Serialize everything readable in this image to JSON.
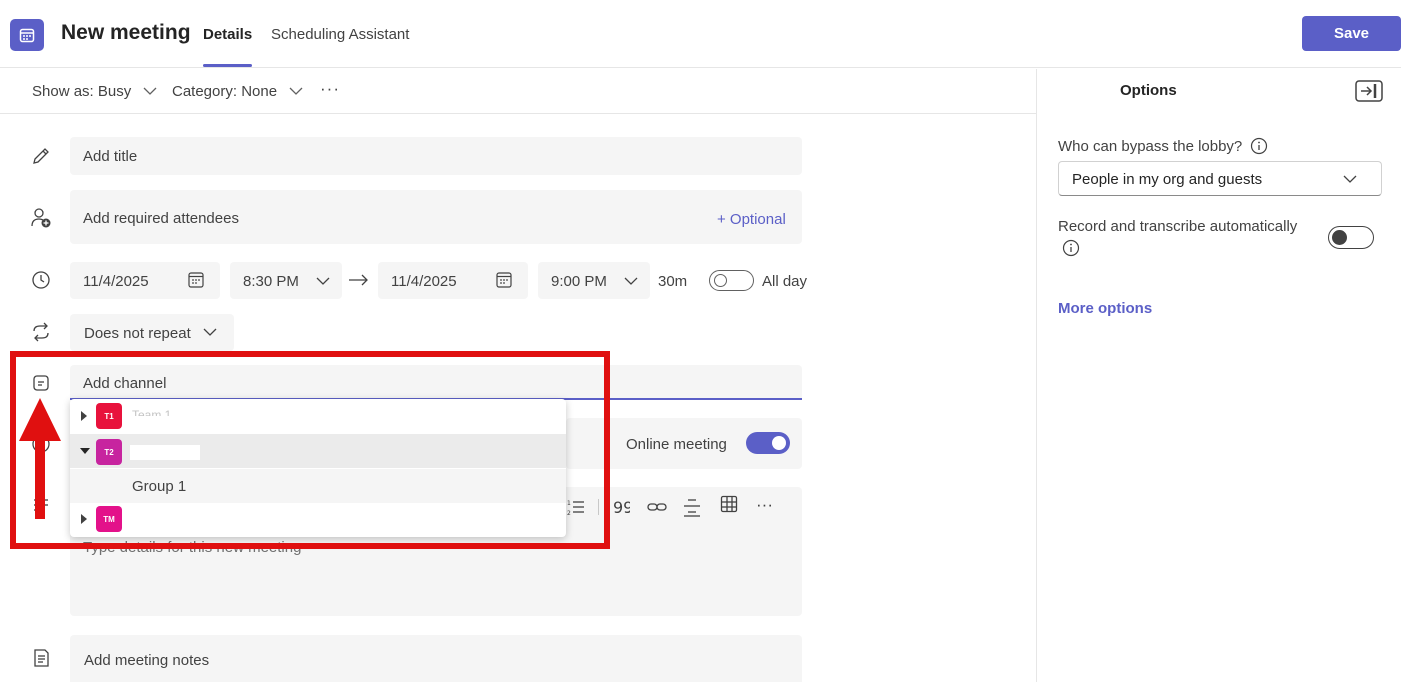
{
  "header": {
    "title": "New meeting",
    "tabs": [
      {
        "label": "Details"
      },
      {
        "label": "Scheduling Assistant"
      }
    ],
    "save_label": "Save"
  },
  "toolbar": {
    "show_as": "Show as: Busy",
    "category": "Category: None",
    "more": "···"
  },
  "form": {
    "title_placeholder": "Add title",
    "attendees_placeholder": "Add required attendees",
    "optional_label": "+ Optional",
    "start_date": "11/4/2025",
    "start_time": "8:30 PM",
    "end_date": "11/4/2025",
    "end_time": "9:00 PM",
    "duration": "30m",
    "all_day_label": "All day",
    "repeat": "Does not repeat",
    "channel_placeholder": "Add channel",
    "online_meeting_label": "Online meeting",
    "details_placeholder": "Type details for this new meeting",
    "notes_placeholder": "Add meeting notes"
  },
  "channel_dropdown": {
    "items": [
      {
        "initials": "T1",
        "name": "Team 1",
        "color": "#e8123c",
        "expanded": false
      },
      {
        "initials": "T2",
        "name": "",
        "color": "#c7249f",
        "expanded": true
      },
      {
        "initials": "TM",
        "name": "",
        "color": "#e3118a",
        "expanded": false
      }
    ],
    "group_label": "Group 1"
  },
  "options_panel": {
    "title": "Options",
    "lobby_label": "Who can bypass the lobby?",
    "lobby_value": "People in my org and guests",
    "record_label": "Record and transcribe automatically",
    "more_options": "More options"
  },
  "colors": {
    "accent": "#5b5fc7",
    "annotation": "#e01010"
  }
}
